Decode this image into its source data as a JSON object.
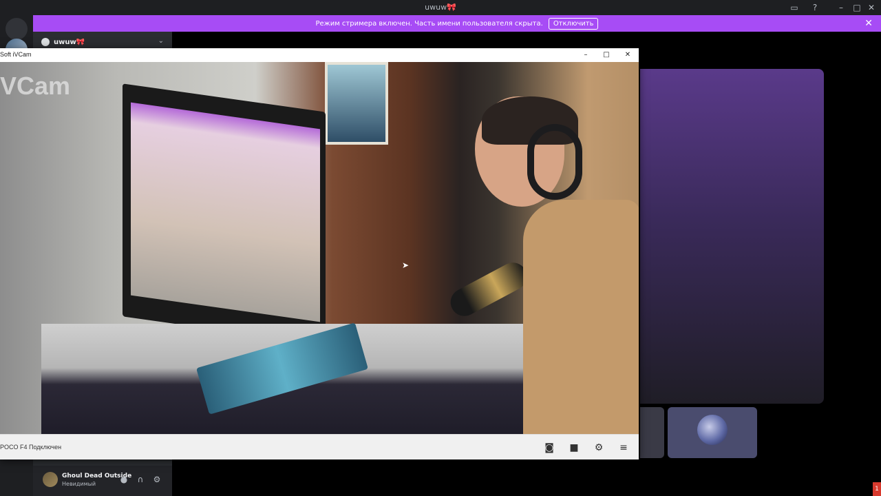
{
  "titlebar": {
    "title": "uwuw🎀",
    "icons": [
      "inbox-icon",
      "help-icon",
      "minimize-icon",
      "maximize-icon",
      "close-icon"
    ]
  },
  "banner": {
    "text": "Режим стримера включен. Часть имени пользователя скрыта.",
    "button": "Отключить"
  },
  "server": {
    "name": "uwuw🎀"
  },
  "user": {
    "name": "Ghoul Dead Outside",
    "status": "Невидимый"
  },
  "ivcam": {
    "title": "Soft iVCam",
    "watermark": "VCam",
    "status": "POCO F4 Подключен",
    "tools": [
      "camera-icon",
      "video-icon",
      "settings-icon",
      "menu-icon"
    ]
  },
  "colors": {
    "banner": "#a74cf5",
    "background": "#1e1f22",
    "sidebar": "#2b2d31"
  }
}
